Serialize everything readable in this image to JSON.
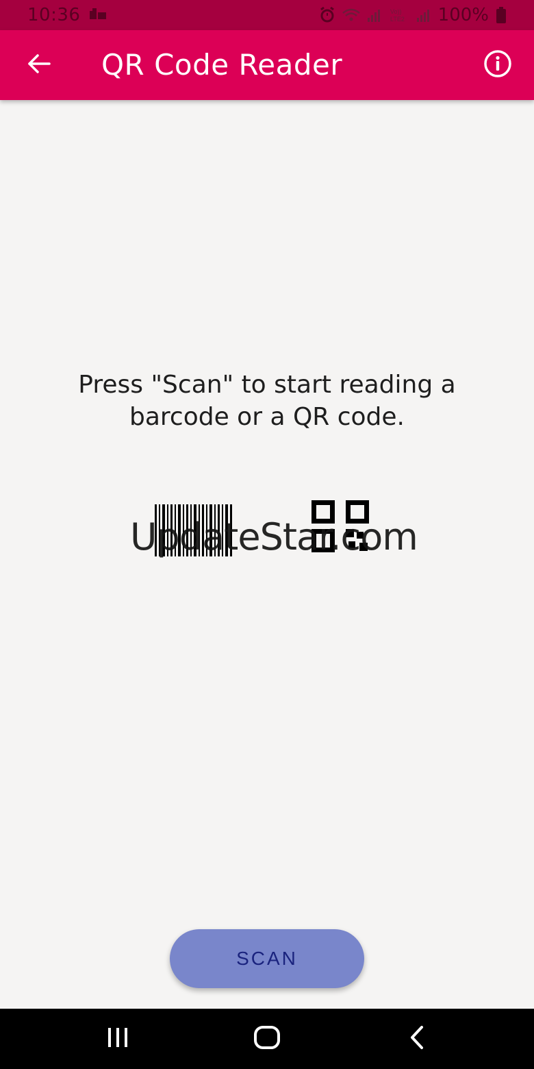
{
  "status_bar": {
    "time": "10:36",
    "battery": "100%",
    "icons": [
      "notification-icon",
      "alarm-icon",
      "wifi-icon",
      "signal-icon",
      "volte-icon",
      "signal-icon",
      "battery-icon"
    ]
  },
  "app_bar": {
    "title": "QR Code Reader",
    "back_icon": "arrow-back-icon",
    "info_icon": "info-icon",
    "color": "#dc0056"
  },
  "main": {
    "message": "Press \"Scan\" to start reading a barcode or a QR code.",
    "watermark": "UpdateStar.com",
    "icons": [
      "barcode-icon",
      "qr-code-icon"
    ]
  },
  "scan_button": {
    "label": "SCAN",
    "color": "#7986cb"
  },
  "nav_bar": {
    "icons": [
      "recent-apps-icon",
      "home-icon",
      "back-icon"
    ]
  }
}
